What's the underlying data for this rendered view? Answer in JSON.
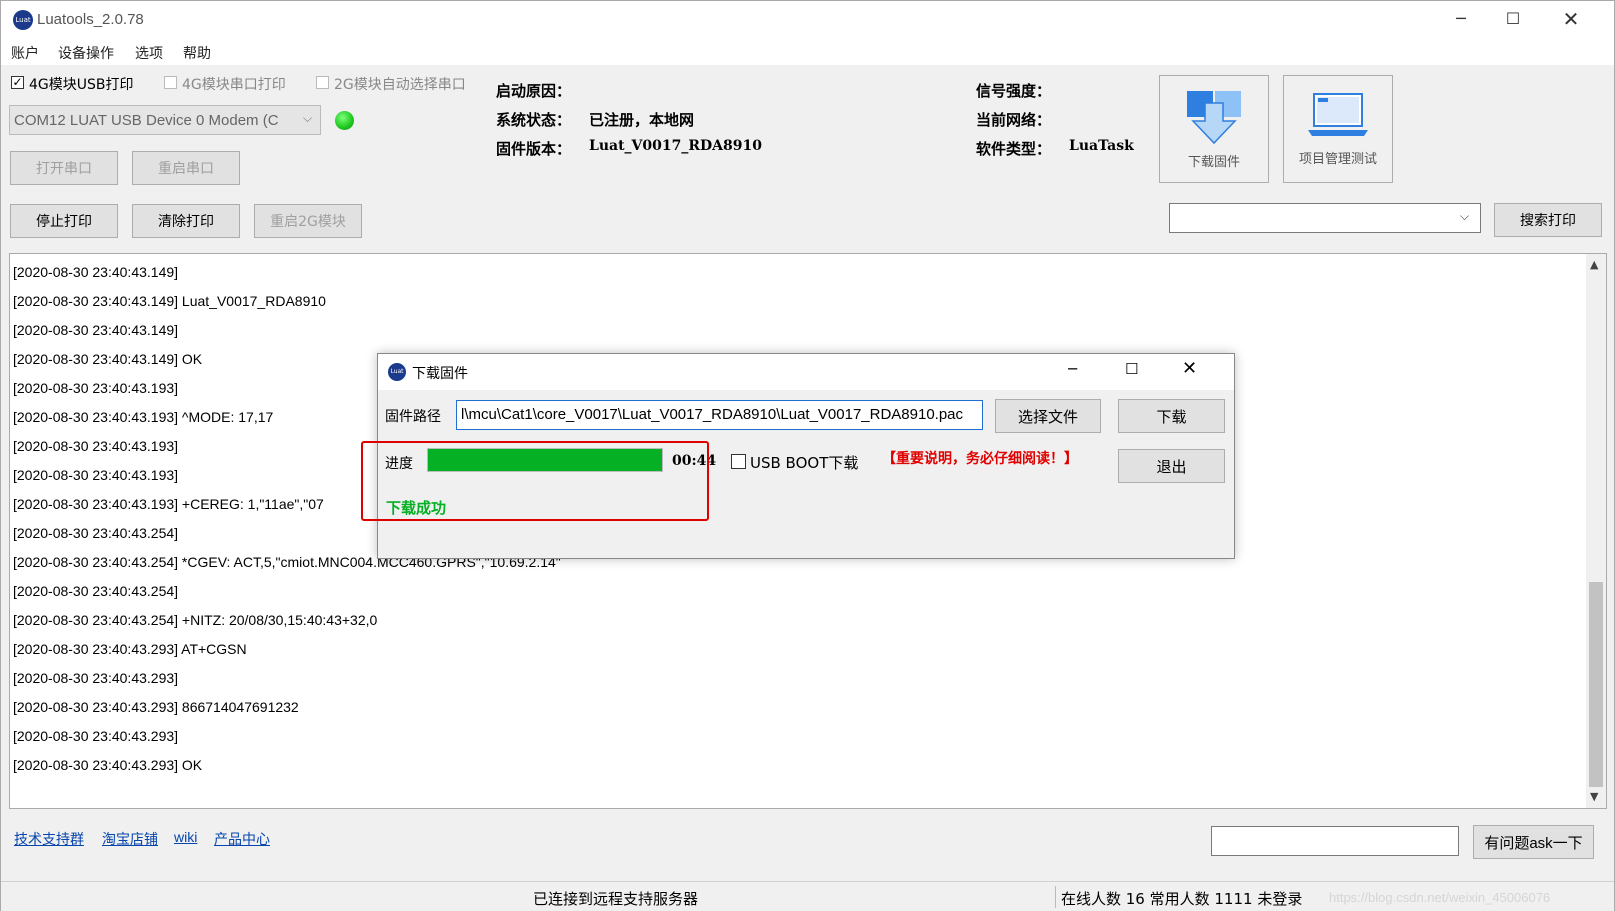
{
  "window": {
    "title": "Luatools_2.0.78"
  },
  "menu": [
    "账户",
    "设备操作",
    "选项",
    "帮助"
  ],
  "options": {
    "usb_print": "4G模块USB打印",
    "serial_print": "4G模块串口打印",
    "auto_2g": "2G模块自动选择串口"
  },
  "port": {
    "selected": "COM12 LUAT USB Device 0 Modem (C"
  },
  "buttons": {
    "open_port": "打开串口",
    "restart_port": "重启串口",
    "stop_print": "停止打印",
    "clear_print": "清除打印",
    "restart_2g": "重启2G模块",
    "search_print": "搜索打印",
    "ask": "有问题ask一下"
  },
  "info": {
    "boot_reason_label": "启动原因：",
    "boot_reason": "",
    "sys_status_label": "系统状态：",
    "sys_status": "已注册，本地网",
    "fw_version_label": "固件版本：",
    "fw_version": "Luat_V0017_RDA8910",
    "signal_label": "信号强度：",
    "signal": "",
    "network_label": "当前网络：",
    "network": "",
    "sw_type_label": "软件类型：",
    "sw_type": "LuaTask"
  },
  "toolbar": {
    "download_fw": "下载固件",
    "project_test": "项目管理测试"
  },
  "log": [
    "[2020-08-30 23:40:43.149]",
    "[2020-08-30 23:40:43.149] Luat_V0017_RDA8910",
    "[2020-08-30 23:40:43.149]",
    "[2020-08-30 23:40:43.149] OK",
    "[2020-08-30 23:40:43.193]",
    "[2020-08-30 23:40:43.193] ^MODE: 17,17",
    "[2020-08-30 23:40:43.193]",
    "[2020-08-30 23:40:43.193]",
    "[2020-08-30 23:40:43.193] +CEREG: 1,\"11ae\",\"07",
    "[2020-08-30 23:40:43.254]",
    "[2020-08-30 23:40:43.254] *CGEV: ACT,5,\"cmiot.MNC004.MCC460.GPRS\",\"10.69.2.14\"",
    "[2020-08-30 23:40:43.254]",
    "[2020-08-30 23:40:43.254] +NITZ: 20/08/30,15:40:43+32,0",
    "[2020-08-30 23:40:43.293] AT+CGSN",
    "[2020-08-30 23:40:43.293]",
    "[2020-08-30 23:40:43.293] 866714047691232",
    "[2020-08-30 23:40:43.293]",
    "[2020-08-30 23:40:43.293] OK"
  ],
  "links": [
    "技术支持群",
    "淘宝店铺",
    "wiki",
    "产品中心"
  ],
  "status": {
    "remote": "已连接到远程支持服务器",
    "online": "在线人数 16 常用人数 1111 未登录",
    "watermark": "https://blog.csdn.net/weixin_45006076"
  },
  "dialog": {
    "title": "下载固件",
    "path_label": "固件路径",
    "path_value": "l\\mcu\\Cat1\\core_V0017\\Luat_V0017_RDA8910\\Luat_V0017_RDA8910.pac",
    "choose_file": "选择文件",
    "download": "下载",
    "progress_label": "进度",
    "progress": 1.0,
    "time": "00:44",
    "usb_boot": "USB BOOT下载",
    "notice": "【重要说明，务必仔细阅读！】",
    "exit": "退出",
    "success": "下载成功"
  },
  "colors": {
    "accent_green": "#06b025",
    "notice_red": "#e00000",
    "highlight_red": "#e00000",
    "led_green": "#22cc22"
  }
}
